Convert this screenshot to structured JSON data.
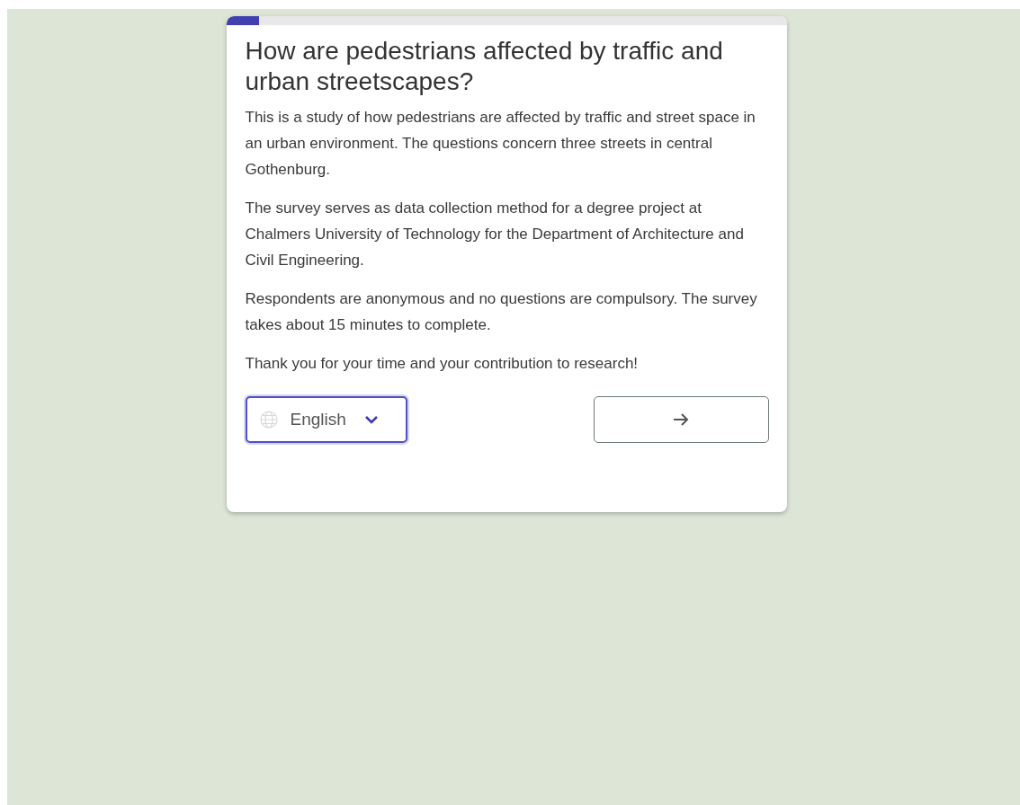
{
  "progress": {
    "level": 0.058
  },
  "title": "How are pedestrians affected by traffic and urban streetscapes?",
  "paragraphs": [
    "This is a study of how pedestrians are affected by traffic and street space in an urban environment. The questions concern three streets in central Gothenburg.",
    "The survey serves as data collection method for a degree project at Chalmers University of Technology for the Department of Architecture and Civil Engineering.",
    "Respondents are anonymous and no questions are compulsory. The survey takes about 15 minutes to complete.",
    "Thank you for your time and your contribution to research!"
  ],
  "language_select": {
    "value": "English"
  }
}
